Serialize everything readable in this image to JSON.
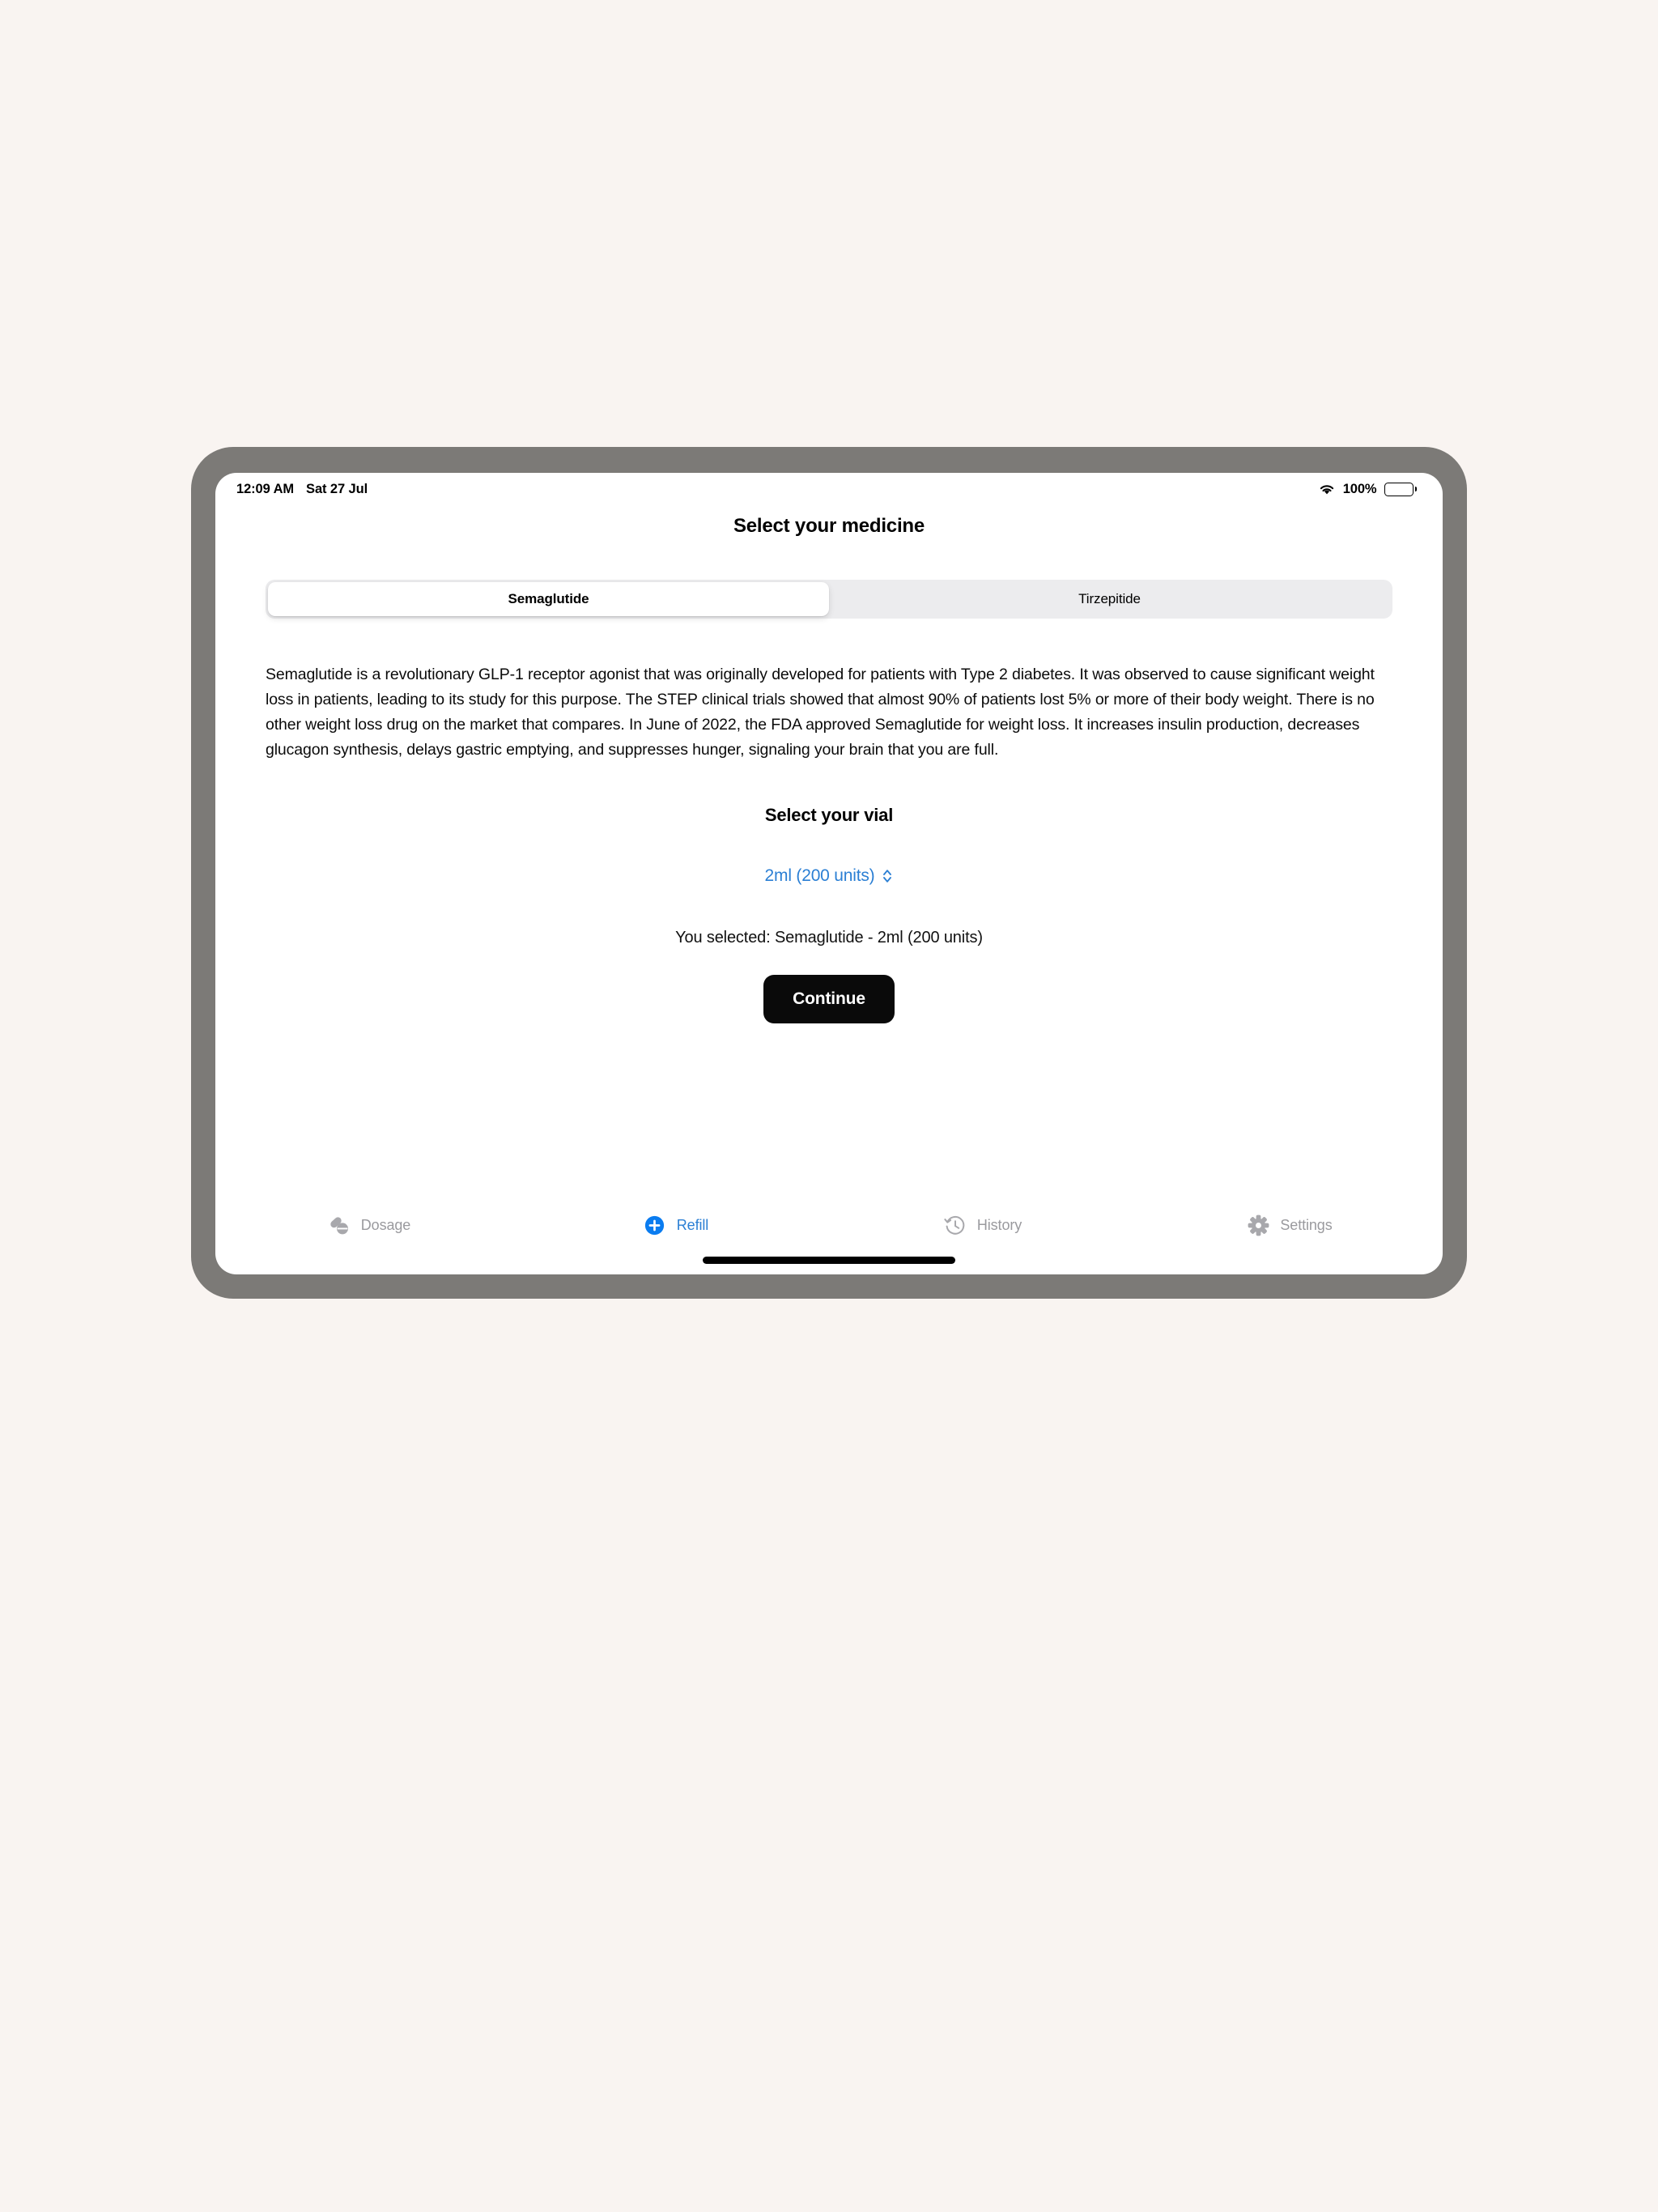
{
  "status_bar": {
    "time": "12:09 AM",
    "date": "Sat 27 Jul",
    "battery_percent": "100%",
    "wifi_icon": "wifi-icon",
    "battery_icon": "battery-full-icon"
  },
  "header": {
    "title": "Select your medicine"
  },
  "medicine_selector": {
    "options": [
      {
        "label": "Semaglutide",
        "selected": true
      },
      {
        "label": "Tirzepitide",
        "selected": false
      }
    ]
  },
  "description": {
    "text": "Semaglutide is a revolutionary GLP-1 receptor agonist that was originally developed for patients with Type 2 diabetes. It was observed to cause significant weight loss in patients, leading to its study for this purpose. The STEP clinical trials showed that almost 90% of patients lost 5% or more of their body weight. There is no other weight loss drug on the market that compares. In June of 2022, the FDA approved Semaglutide for weight loss. It increases insulin production, decreases glucagon synthesis, delays gastric emptying, and suppresses hunger, signaling your brain that you are full."
  },
  "vial_section": {
    "heading": "Select your vial",
    "selected_vial": "2ml (200 units)",
    "stepper_icon": "chevron-up-down-icon",
    "summary": "You selected: Semaglutide - 2ml (200 units)"
  },
  "actions": {
    "continue_label": "Continue"
  },
  "tab_bar": {
    "items": [
      {
        "label": "Dosage",
        "icon": "pills-icon",
        "active": false
      },
      {
        "label": "Refill",
        "icon": "plus-circle-icon",
        "active": true
      },
      {
        "label": "History",
        "icon": "clock-arrow-icon",
        "active": false
      },
      {
        "label": "Settings",
        "icon": "gear-icon",
        "active": false
      }
    ]
  },
  "colors": {
    "accent_blue": "#2b7fd4",
    "refill_blue": "#0a7cf0",
    "button_black": "#0a0a0a",
    "page_background": "#f9f4f1",
    "bezel_gray": "#7c7a77",
    "segment_track": "#ececee",
    "tab_inactive": "#9a9a9e"
  }
}
